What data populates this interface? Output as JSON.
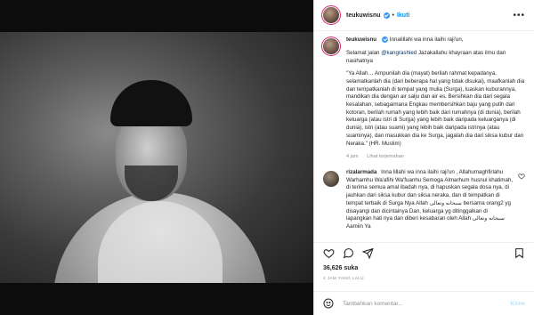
{
  "post": {
    "username": "teukuwisnu",
    "follow_label": "Ikuti",
    "more_label": "•••"
  },
  "caption": {
    "username": "teukuwisnu",
    "line1": "Innalillahi wa inna ilaihi raji'un,",
    "p2_prefix": "Selamat jalan ",
    "p2_mention": "@kangrashied",
    "p2_suffix": " Jazakallahu khayraan atas ilmu dan nasihatnya",
    "p3": "\"Ya Allah… Ampunilah dia (mayat) berilah rahmat kepadanya, selamatkanlah dia (dari beberapa hal yang tidak disukai), maafkanlah dia dan tempatkanlah di tempat yang mulia (Surga), luaskan kuburannya, mandikan dia dengan air salju dan air es. Bersihkan dia dari segala kesalahan, sebagaimana Engkau membersihkan baju yang putih dari kotoran, berilah rumah yang lebih baik dari rumahnya (di dunia), berilah keluarga (atau istri di Surga) yang lebih baik daripada keluarganya (di dunia), istri (atau suami) yang lebih baik daripada istrinya (atau suaminya), dan masukkan dia ke Surga, jagalah dia dari siksa kubur dan Neraka.\" (HR. Muslim)",
    "time": "4 jam",
    "translate_label": "Lihat terjemahan"
  },
  "comment": {
    "username": "rizalarmada",
    "text": "Inna lillahi wa inna ilaihi raji'un , Allahumaghfirlahu Warhamhu Wa'afihi Wa'fuanhu Semoga Almarhum husnul khatimah, di terima semua amal ibadah nya, di hapuskan segala dosa nya, di jauhkan dari siksa kubur dan siksa neraka, dan di tempatkan di tempat terbaik di Surga Nya Allah سبحانه وتعالى bersama orang2 yg disayangi dan dicintainya Dan, keluarga yg ditinggalkan di lapangkan hati nya dan diberi kesabaran oleh Allah سبحانه وتعالى Aamiin Ya"
  },
  "engagement": {
    "likes": "36,626 suka",
    "time_ago": "4 JAM YANG LALU"
  },
  "composer": {
    "placeholder": "Tambahkan komentar...",
    "post_label": "Kirim"
  },
  "colors": {
    "accent": "#0095f6",
    "verified": "#3897f0",
    "text": "#262626",
    "muted": "#8e8e8e"
  },
  "icons": [
    "verified-badge-icon",
    "more-icon",
    "heart-icon",
    "comment-icon",
    "share-icon",
    "bookmark-icon",
    "emoji-icon",
    "user-tag-icon"
  ]
}
